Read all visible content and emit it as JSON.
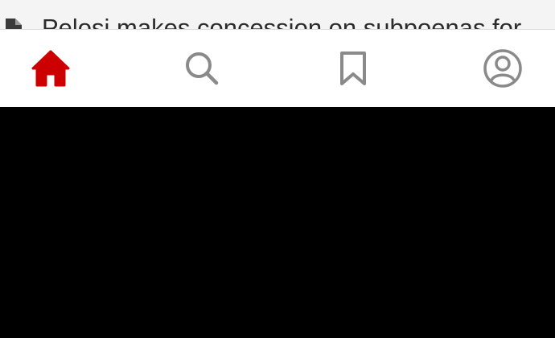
{
  "article_peek": {
    "title": "Pelosi makes concession on subpoenas for",
    "icon": "document-icon"
  },
  "tab_bar": {
    "active_color": "#cc0000",
    "inactive_color": "#8a8a8a",
    "tabs": [
      {
        "icon": "home-icon",
        "active": true
      },
      {
        "icon": "search-icon",
        "active": false
      },
      {
        "icon": "bookmark-icon",
        "active": false
      },
      {
        "icon": "profile-icon",
        "active": false
      }
    ]
  }
}
